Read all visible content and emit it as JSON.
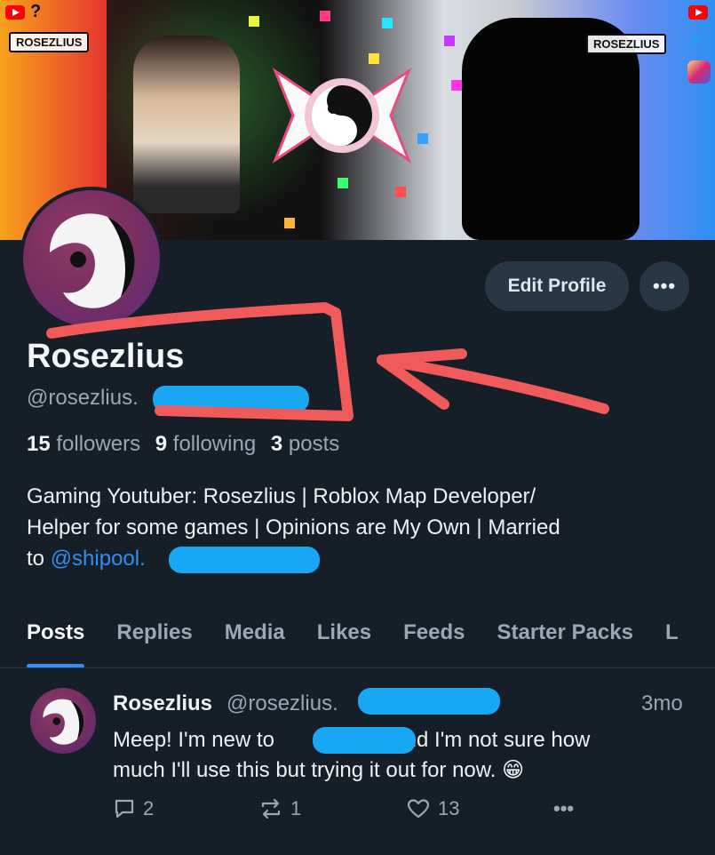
{
  "banner": {
    "left_logo": "ROSEZLIUS",
    "right_logo": "ROSEZLIUS",
    "help_icon": "?"
  },
  "profile": {
    "display_name": "Rosezlius",
    "handle": "@rosezlius.",
    "followers_count": "15",
    "followers_label": "followers",
    "following_count": "9",
    "following_label": "following",
    "posts_count": "3",
    "posts_label": "posts",
    "bio_line1": "Gaming Youtuber: Rosezlius | Roblox Map Developer/",
    "bio_line2": "Helper for some games | Opinions are My Own | Married",
    "bio_line3_prefix": "to ",
    "bio_mention": "@shipool."
  },
  "buttons": {
    "edit_profile": "Edit Profile",
    "more": "•••"
  },
  "tabs": [
    {
      "label": "Posts",
      "active": true
    },
    {
      "label": "Replies",
      "active": false
    },
    {
      "label": "Media",
      "active": false
    },
    {
      "label": "Likes",
      "active": false
    },
    {
      "label": "Feeds",
      "active": false
    },
    {
      "label": "Starter Packs",
      "active": false
    },
    {
      "label": "L",
      "active": false
    }
  ],
  "post": {
    "author_name": "Rosezlius",
    "author_handle": "@rosezlius.",
    "time": "3mo",
    "text_part1": "Meep! I'm new to",
    "text_part2": ", and I'm not sure how",
    "text_line2": "much I'll use this but trying it out for now. 😁",
    "reply_count": "2",
    "repost_count": "1",
    "like_count": "13",
    "more": "•••"
  },
  "colors": {
    "background": "#161e27",
    "accent": "#2f8ff3",
    "button_bg": "#283646",
    "muted_text": "#9aa7b5",
    "annotation_red": "#f05a5a",
    "redaction_blue": "#18a7f2"
  },
  "icons": {
    "reply": "reply-icon",
    "repost": "repost-icon",
    "like": "heart-icon",
    "more": "more-icon"
  }
}
